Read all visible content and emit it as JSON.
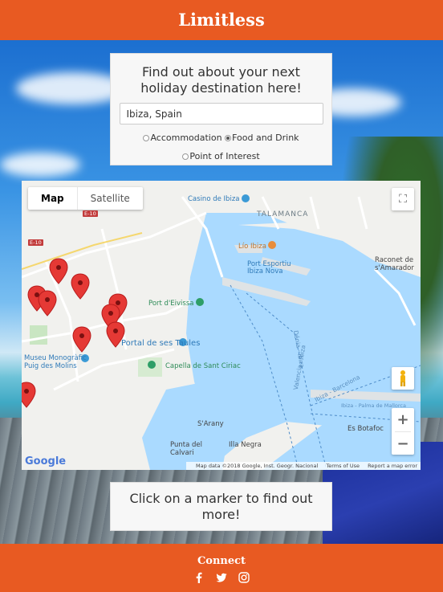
{
  "header": {
    "title": "Limitless"
  },
  "search": {
    "title": "Find out about your next holiday destination here!",
    "input_value": "Ibiza, Spain",
    "placeholder": "",
    "options": [
      {
        "label": "Accommodation",
        "selected": false
      },
      {
        "label": "Food and Drink",
        "selected": true
      },
      {
        "label": "Point of Interest",
        "selected": false
      }
    ]
  },
  "map": {
    "type_controls": {
      "map": "Map",
      "satellite": "Satellite"
    },
    "labels": {
      "casino": "Casino de Ibiza",
      "talamanca": "TALAMANCA",
      "lio": "Lío Ibiza",
      "port_esportiu": "Port Esportiu Ibiza Nova",
      "raconet": "Raconet de s'Amarador",
      "port_deivissa": "Port d'Eivissa",
      "portal": "Portal de ses Taules",
      "museu": "Museu Monogràfic Puig des Molins",
      "capella": "Capella de Sant Ciriac",
      "es_botafoc": "Es Botafoc",
      "sarany": "S'Arany",
      "punta": "Punta del Calvari",
      "illa": "Illa Negra",
      "ibiza_barcelona": "Ibiza - Barcelona",
      "valencia_ibiza": "Valencia - Ibiza",
      "denia_ibiza": "Dénia - Ibiza",
      "palma": "Ibiza - Palma de Mallorca",
      "road_e10a": "E-10",
      "road_e10b": "E-10"
    },
    "google_logo": "Google",
    "attribution": {
      "data": "Map data ©2018 Google, Inst. Geogr. Nacional",
      "terms": "Terms of Use",
      "report": "Report a map error"
    }
  },
  "info": {
    "text": "Click on a marker to find out more!"
  },
  "footer": {
    "title": "Connect",
    "icons": [
      "facebook-icon",
      "twitter-icon",
      "instagram-icon"
    ]
  },
  "colors": {
    "brand": "#e85a22",
    "marker": "#e53935",
    "water": "#aadaff"
  }
}
